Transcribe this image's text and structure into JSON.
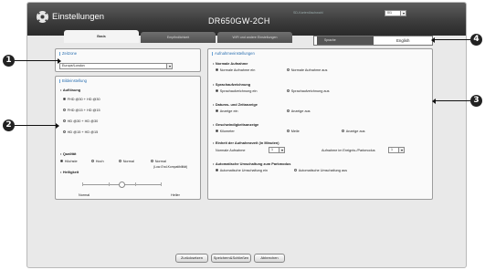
{
  "window": {
    "title": "Einstellungen",
    "model": "DR650GW-2CH"
  },
  "tabs": [
    {
      "label": "Basis",
      "active": true
    },
    {
      "label": "Empfindlichkeit",
      "active": false
    },
    {
      "label": "WiFi und andere Einstellungen",
      "active": false
    }
  ],
  "top_right": {
    "sd_label": "SD-Kartenlöschwahl",
    "sd_value": "0/1",
    "language_label": "Sprache",
    "language_value": "English"
  },
  "timezone": {
    "title": "Zeitzone",
    "value": "Europe/London"
  },
  "video": {
    "title": "Bildeinstellung",
    "resolution_label": "Auflösung",
    "resolutions": [
      {
        "label": "FHD @30 + HD @30",
        "selected": true
      },
      {
        "label": "FHD @15 + HD @15",
        "selected": false
      },
      {
        "label": "HD @30 + HD @30",
        "selected": false
      },
      {
        "label": "HD @15 + HD @15",
        "selected": false
      }
    ],
    "quality_label": "Qualität",
    "qualities": [
      {
        "label": "Höchste",
        "selected": true
      },
      {
        "label": "Hoch",
        "selected": false
      },
      {
        "label": "Normal",
        "selected": false
      },
      {
        "label": "Normal",
        "selected": false
      }
    ],
    "quality_note": "(Low-End-Kompatibilität)",
    "brightness_label": "Helligkeit",
    "brightness_level": 0.5,
    "brightness_min": "Normal",
    "brightness_max": "Heller"
  },
  "recording": {
    "title": "Aufnahmeeinstellungen",
    "normal": {
      "label": "Normale Aufnahme",
      "options": [
        {
          "label": "Normale Aufnahme ein",
          "selected": true
        },
        {
          "label": "Normale Aufnahme aus",
          "selected": false
        }
      ]
    },
    "voice": {
      "label": "Sprachaufzeichnung",
      "options": [
        {
          "label": "Sprachaufzeichnung ein",
          "selected": true
        },
        {
          "label": "Sprachaufzeichnung aus",
          "selected": false
        }
      ]
    },
    "datetime": {
      "label": "Datums- und Zeitanzeige",
      "options": [
        {
          "label": "Anzeige ein",
          "selected": true
        },
        {
          "label": "Anzeige aus",
          "selected": false
        }
      ]
    },
    "speed": {
      "label": "Geschwindigkeitsanzeige",
      "options": [
        {
          "label": "Kilometer",
          "selected": true
        },
        {
          "label": "Meile",
          "selected": false
        },
        {
          "label": "Anzeige aus",
          "selected": false
        }
      ]
    },
    "unit": {
      "label": "Einheit der Aufnahmezeit (in Minuten)",
      "normal_label": "Normale Aufnahme",
      "normal_value": "1",
      "event_label": "Aufnahme im Ereignis-/Parkmodus",
      "event_value": "1"
    },
    "parking": {
      "label": "Automatische Umschaltung zum Parkmodus",
      "options": [
        {
          "label": "Automatische Umschaltung ein",
          "selected": true
        },
        {
          "label": "Automatische Umschaltung aus",
          "selected": false
        }
      ]
    }
  },
  "buttons": {
    "reset": "Zurücksetzen",
    "save_close": "Speichern&Schließen",
    "cancel": "Abbrechen"
  },
  "callouts": [
    "1",
    "2",
    "3",
    "4"
  ]
}
